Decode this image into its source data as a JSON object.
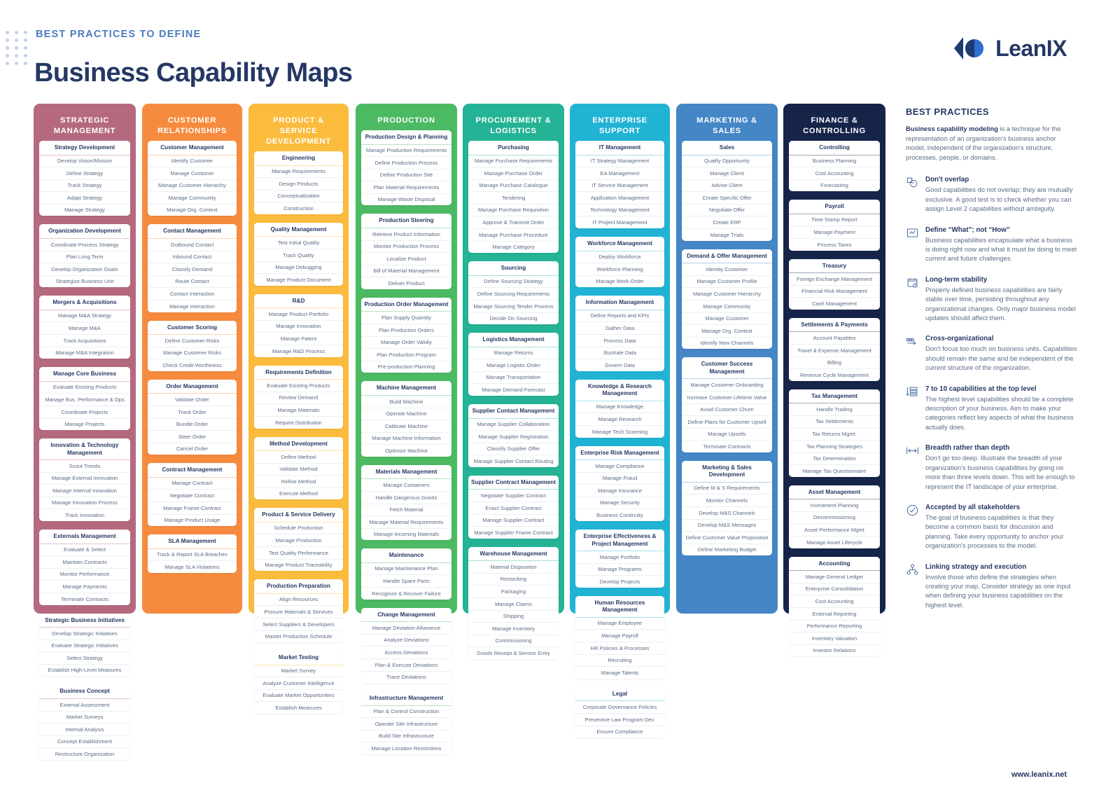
{
  "header": {
    "kicker": "BEST PRACTICES TO DEFINE",
    "title": "Business Capability Maps",
    "brand": "LeanIX"
  },
  "footer": {
    "url": "www.leanix.net"
  },
  "colors": {
    "strategic": "#b5697f",
    "customer": "#f68b3f",
    "product": "#fbbb3c",
    "production": "#4cb963",
    "procurement": "#25b396",
    "enterprise": "#21b3d4",
    "marketing": "#4486c6",
    "finance": "#16244a",
    "accent": "#253864",
    "body_text": "#5b6b86"
  },
  "columns": [
    {
      "key": "strategic-management",
      "title": "STRATEGIC MANAGEMENT",
      "color": "#b5697f",
      "groups": [
        {
          "name": "Strategy Development",
          "items": [
            "Develop Vision/Mission",
            "Define Strategy",
            "Track Strategy",
            "Adapt Strategy",
            "Manage Strategy"
          ]
        },
        {
          "name": "Organization Development",
          "items": [
            "Coordinate Process Strategy",
            "Plan Long Term",
            "Develop Organization Goals",
            "Strategize Business Unit"
          ]
        },
        {
          "name": "Mergers & Acquisitions",
          "items": [
            "Manage M&A Strategy",
            "Manage M&A",
            "Track Acquisitions",
            "Manage M&A Integration"
          ]
        },
        {
          "name": "Manage Core Business",
          "items": [
            "Evaluate Existing Products",
            "Manage Bus. Performance & Ops",
            "Coordinate Projects",
            "Manage Projects"
          ]
        },
        {
          "name": "Innovation & Technology Management",
          "items": [
            "Scout Trends",
            "Manage External Innovation",
            "Manage Internal Innovation",
            "Manage Innovation Process",
            "Track Innovation"
          ]
        },
        {
          "name": "Externals Management",
          "items": [
            "Evaluate & Select",
            "Maintain Contracts",
            "Monitor Performance",
            "Manage Payments",
            "Terminate Contracts"
          ]
        },
        {
          "name": "Strategic Business Initiatives",
          "items": [
            "Develop Strategic Initiatives",
            "Evaluate Strategic Initiatives",
            "Select Strategy",
            "Establish High-Level Measures"
          ]
        },
        {
          "name": "Business Concept",
          "items": [
            "External Assessment",
            "Market Surveys",
            "Internal Analysis",
            "Concept Establishment",
            "Restructure Organization"
          ]
        }
      ]
    },
    {
      "key": "customer-relationships",
      "title": "CUSTOMER RELATIONSHIPS",
      "color": "#f68b3f",
      "groups": [
        {
          "name": "Customer Management",
          "items": [
            "Identify Customer",
            "Manage Customer",
            "Manage Customer Hierarchy",
            "Manage Community",
            "Manage Org. Context"
          ]
        },
        {
          "name": "Contact Management",
          "items": [
            "Outbound Contact",
            "Inbound Contact",
            "Classify Demand",
            "Route Contact",
            "Contact Interaction",
            "Manage Interaction"
          ]
        },
        {
          "name": "Customer Scoring",
          "items": [
            "Define Customer Risks",
            "Manage Customer Risks",
            "Check Credit-Worthiness"
          ]
        },
        {
          "name": "Order Management",
          "items": [
            "Validate Order",
            "Track Order",
            "Bundle Order",
            "Steer Order",
            "Cancel Order"
          ]
        },
        {
          "name": "Contract Management",
          "items": [
            "Manage Contract",
            "Negotiate Contract",
            "Manage Frame-Contract",
            "Manage Product Usage"
          ]
        },
        {
          "name": "SLA Management",
          "items": [
            "Track & Report SLA Breaches",
            "Manage SLA Violations"
          ]
        }
      ]
    },
    {
      "key": "product-service-development",
      "title": "PRODUCT & SERVICE DEVELOPMENT",
      "color": "#fbbb3c",
      "groups": [
        {
          "name": "Engineering",
          "items": [
            "Manage Requirements",
            "Design Products",
            "Conceptualization",
            "Construction"
          ]
        },
        {
          "name": "Quality Management",
          "items": [
            "Test Initial Quality",
            "Track Quality",
            "Manage Debugging",
            "Manage Product Document"
          ]
        },
        {
          "name": "R&D",
          "items": [
            "Manage Product Portfolio",
            "Manage Innovation",
            "Manage Patent",
            "Manage R&D Process"
          ]
        },
        {
          "name": "Requirements Definition",
          "items": [
            "Evaluate Existing Products",
            "Review Demand",
            "Manage Materials",
            "Require Distribution"
          ]
        },
        {
          "name": "Method Development",
          "items": [
            "Define Method",
            "Validate Method",
            "Refine Method",
            "Execute Method"
          ]
        },
        {
          "name": "Product & Service Delivery",
          "items": [
            "Schedule Production",
            "Manage Production",
            "Test Quality Performance",
            "Manage Product Traceability"
          ]
        },
        {
          "name": "Production Preparation",
          "items": [
            "Align Resources",
            "Procure Materials & Services",
            "Select Suppliers & Developers",
            "Master Production Schedule"
          ]
        },
        {
          "name": "Market Testing",
          "items": [
            "Market Survey",
            "Analyze Customer Intelligence",
            "Evaluate Market Opportunities",
            "Establish Measures"
          ]
        }
      ]
    },
    {
      "key": "production",
      "title": "PRODUCTION",
      "color": "#4cb963",
      "groups": [
        {
          "name": "Production Design & Planning",
          "items": [
            "Manage Production Requirements",
            "Define Production Process",
            "Define Production Site",
            "Plan Material Requirements",
            "Manage Waste Disposal"
          ]
        },
        {
          "name": "Production Steering",
          "items": [
            "Retrieve Product Information",
            "Monitor Production Process",
            "Localize Product",
            "Bill of Material Management",
            "Deliver Product"
          ]
        },
        {
          "name": "Production Order Management",
          "items": [
            "Plan Supply Quantity",
            "Plan Production Orders",
            "Manage Order Validiy",
            "Plan Production Program",
            "Pre-production Planning"
          ]
        },
        {
          "name": "Machine Management",
          "items": [
            "Build Machine",
            "Operate Machine",
            "Calibrate Machine",
            "Manage Machine Information",
            "Optimize Machine"
          ]
        },
        {
          "name": "Materials Management",
          "items": [
            "Manage Containers",
            "Handle Dangerous Goods",
            "Fetch Material",
            "Manage Material Requirements",
            "Manage Incoming Materials"
          ]
        },
        {
          "name": "Maintenance",
          "items": [
            "Manage Maintenance Plan",
            "Handle Spare Parts",
            "Recognize & Recover Failure"
          ]
        },
        {
          "name": "Change Management",
          "items": [
            "Manage Deviation Allowance",
            "Analyze Deviations",
            "Access Deviations",
            "Plan & Execute Deviations",
            "Trace Deviations"
          ]
        },
        {
          "name": "Infrastructure Management",
          "items": [
            "Plan & Control Construction",
            "Operate Site Infrastructure",
            "Build Site Infrastructure",
            "Manage Location Restrictions"
          ]
        }
      ]
    },
    {
      "key": "procurement-logistics",
      "title": "PROCUREMENT & LOGISTICS",
      "color": "#25b396",
      "groups": [
        {
          "name": "Purchasing",
          "items": [
            "Manage Purchase Requirements",
            "Manage Purchase Order",
            "Manage Purchase Catalogue",
            "Tendering",
            "Manage Purchase Requisition",
            "Approve & Transmit Order",
            "Manage Purchase Procedure",
            "Manage Category"
          ]
        },
        {
          "name": "Sourcing",
          "items": [
            "Define Sourcing Strategy",
            "Define Sourcing Requirements",
            "Manage Sourcing Tender Process",
            "Decide On Sourcing"
          ]
        },
        {
          "name": "Logistics Management",
          "items": [
            "Manage Returns",
            "Manage Logistic Order",
            "Manage Transportation",
            "Manage Demand Forecast"
          ]
        },
        {
          "name": "Supplier Contact Management",
          "items": [
            "Manage Supplier Collaboration",
            "Manage Supplier Registration",
            "Classify Supplier Offer",
            "Manage Supplier Contact Routing"
          ]
        },
        {
          "name": "Supplier Contract Management",
          "items": [
            "Negotiate Supplier Contract",
            "Enact Supplier Contract",
            "Manage Supplier Contract",
            "Manage Supplier Frame Contract"
          ]
        },
        {
          "name": "Warehouse Management",
          "items": [
            "Material Disposition",
            "Restocking",
            "Packaging",
            "Manage Claims",
            "Shipping",
            "Manage Inventory",
            "Commissioning",
            "Goods Receipt & Service Entry"
          ]
        }
      ]
    },
    {
      "key": "enterprise-support",
      "title": "ENTERPRISE SUPPORT",
      "color": "#21b3d4",
      "groups": [
        {
          "name": "IT Management",
          "items": [
            "IT Strategy Management",
            "EA Management",
            "IT Service Management",
            "Application Management",
            "Technology Management",
            "IT Project Management"
          ]
        },
        {
          "name": "Workforce Management",
          "items": [
            "Deploy Workforce",
            "Workforce Planning",
            "Manage Work Order"
          ]
        },
        {
          "name": "Information Management",
          "items": [
            "Define Reports and KPIs",
            "Gather Data",
            "Process Data",
            "Illustrate Data",
            "Govern Data"
          ]
        },
        {
          "name": "Knowledge & Research Management",
          "items": [
            "Manage Knowledge",
            "Manage Research",
            "Manage Tech Scanning"
          ]
        },
        {
          "name": "Enterprise Risk Management",
          "items": [
            "Manage Compliance",
            "Manage Fraud",
            "Manage Insurance",
            "Manage Security",
            "Business Continuity"
          ]
        },
        {
          "name": "Enterprise Effectiveness & Project Management",
          "items": [
            "Manage Portfolio",
            "Manage Programs",
            "Develop Projects"
          ]
        },
        {
          "name": "Human Resources Management",
          "items": [
            "Manage Employee",
            "Manage Payroll",
            "HR Policies & Processes",
            "Recruiting",
            "Manage Talents"
          ]
        },
        {
          "name": "Legal",
          "items": [
            "Corporate Governance Policies",
            "Preventive Law Program Dev.",
            "Ensure Compliance"
          ]
        }
      ]
    },
    {
      "key": "marketing-sales",
      "title": "MARKETING & SALES",
      "color": "#4486c6",
      "groups": [
        {
          "name": "Sales",
          "items": [
            "Qualify Opportunity",
            "Manage Client",
            "Advise Client",
            "Create Specific Offer",
            "Negotiate Offer",
            "Create ERP",
            "Manage Trials"
          ]
        },
        {
          "name": "Demand & Offer Management",
          "items": [
            "Identity Customer",
            "Manage Customer Profile",
            "Manage Customer Hierarchy",
            "Manage Community",
            "Manage Customer",
            "Manage Org. Context",
            "Identify New Channels"
          ]
        },
        {
          "name": "Customer Success Management",
          "items": [
            "Manage Customer Onboarding",
            "Increase Customer Lifetime Value",
            "Avoid Customer Churn",
            "Define Plans for Customer Upsell",
            "Manage Upsells",
            "Terminate Contracts"
          ]
        },
        {
          "name": "Marketing & Sales Development",
          "items": [
            "Define M & S Requirements",
            "Monitor Channels",
            "Develop M&S Channels",
            "Develop M&S Messages",
            "Define Customer Value Proposition",
            "Define Marketing Budget"
          ]
        }
      ]
    },
    {
      "key": "finance-controlling",
      "title": "FINANCE & CONTROLLING",
      "color": "#16244a",
      "groups": [
        {
          "name": "Controlling",
          "items": [
            "Business Planning",
            "Cost Accounting",
            "Forecasting"
          ]
        },
        {
          "name": "Payroll",
          "items": [
            "Time Stamp Report",
            "Manage Payment",
            "Process Taxes"
          ]
        },
        {
          "name": "Treasury",
          "items": [
            "Foreign Exchange Management",
            "Financial Risk Management",
            "Cash Management"
          ]
        },
        {
          "name": "Settlements & Payments",
          "items": [
            "Account Payables",
            "Travel & Expense Management",
            "Billing",
            "Revenue Cycle Management"
          ]
        },
        {
          "name": "Tax Management",
          "items": [
            "Handle Trading",
            "Tax Settlements",
            "Tax Returns Mgmt.",
            "Tax Planning Strategies",
            "Tax Determination",
            "Manage Tax Questionnaire"
          ]
        },
        {
          "name": "Asset Management",
          "items": [
            "Investment Planning",
            "Decommissioning",
            "Asset Performance Mgmt",
            "Manage Asset Lifecycle"
          ]
        },
        {
          "name": "Accounting",
          "items": [
            "Manage General Ledger",
            "Enterprise Consolidation",
            "Cost Accounting",
            "External Reporting",
            "Performance Reporting",
            "Inventory Valuation",
            "Investor Relations"
          ]
        }
      ]
    }
  ],
  "best_practices": {
    "title": "BEST PRACTICES",
    "intro_bold": "Business capability modeling",
    "intro_rest": " is a technique for the representation of an organization's business anchor model, independent of the organization's structure, processes, people, or domains.",
    "items": [
      {
        "icon": "overlap-icon",
        "heading": "Don't overlap",
        "body": "Good capabilities do not overlap; they are mutually exclusive. A good test is to check whether you can assign Level 2 capabilities without ambiguity."
      },
      {
        "icon": "what-not-how-icon",
        "heading": "Define “What”; not “How”",
        "body": "Business capabilities encapsulate what a business is doing right now and what it must be doing to meet current and future challenges."
      },
      {
        "icon": "calendar-clock-icon",
        "heading": "Long-term stability",
        "body": "Properly defined business capabilities are fairly stable over time, persisting throughout any organizational changes. Only major business model updates should affect them."
      },
      {
        "icon": "cross-org-icon",
        "heading": "Cross-organizational",
        "body": "Don't focus too much on business units. Capabilities should remain the same and be independent of the current structure of the organization."
      },
      {
        "icon": "levels-icon",
        "heading": "7 to 10 capabilities at the top level",
        "body": "The highest level capabilities should be a complete description of your business. Aim to make your categories reflect key aspects of what the business actually does."
      },
      {
        "icon": "breadth-arrow-icon",
        "heading": "Breadth rather than depth",
        "body": "Don't go too deep. Illustrate the breadth of your organization's business capabilities by going no more than three levels down. This will be enough to represent the IT landscape of your enterprise."
      },
      {
        "icon": "check-circle-icon",
        "heading": "Accepted by all stakeholders",
        "body": "The goal of business capabilities is that they become a common basis for discussion and planning. Take every opportunity to anchor your organization's processes to the model."
      },
      {
        "icon": "network-nodes-icon",
        "heading": "Linking strategy and execution",
        "body": "Involve those who define the strategies when creating your map. Consider strategy as one input when defining your business capabilities on the highest level."
      }
    ]
  }
}
